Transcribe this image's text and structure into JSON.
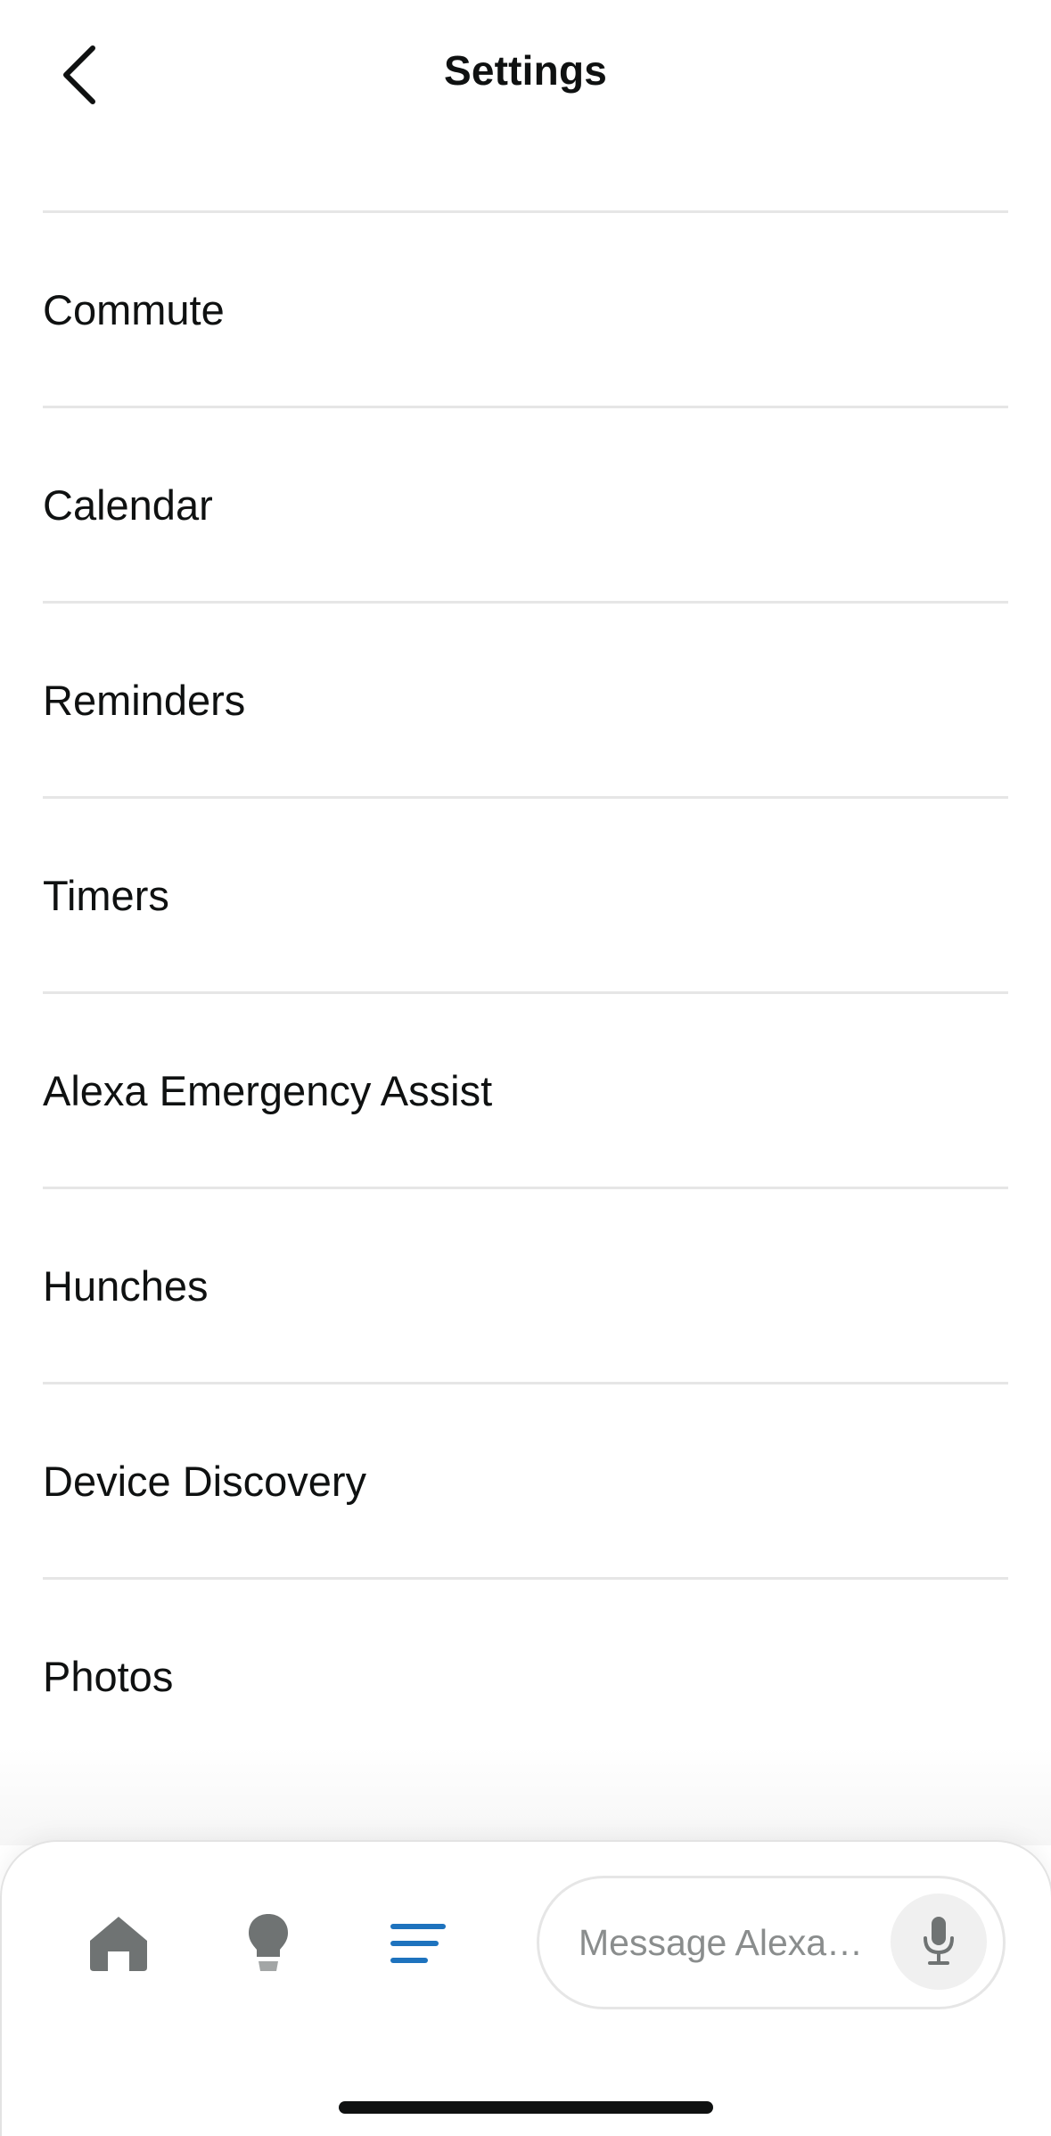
{
  "header": {
    "title": "Settings",
    "back_icon": "chevron-left-icon"
  },
  "settings": {
    "items": [
      {
        "label": "Commute"
      },
      {
        "label": "Calendar"
      },
      {
        "label": "Reminders"
      },
      {
        "label": "Timers"
      },
      {
        "label": "Alexa Emergency Assist"
      },
      {
        "label": "Hunches"
      },
      {
        "label": "Device Discovery"
      },
      {
        "label": "Photos"
      }
    ]
  },
  "bottom_nav": {
    "items": [
      {
        "icon": "home-icon",
        "active": false
      },
      {
        "icon": "lightbulb-icon",
        "active": false
      },
      {
        "icon": "menu-lines-icon",
        "active": true
      }
    ],
    "message": {
      "placeholder": "Message Alexa…",
      "value": "",
      "mic_icon": "microphone-icon"
    }
  },
  "colors": {
    "text": "#0f1111",
    "divider": "#e6e6e6",
    "accent": "#1e73be",
    "icon_inactive": "#6f7373",
    "placeholder": "#8a8d8d"
  }
}
